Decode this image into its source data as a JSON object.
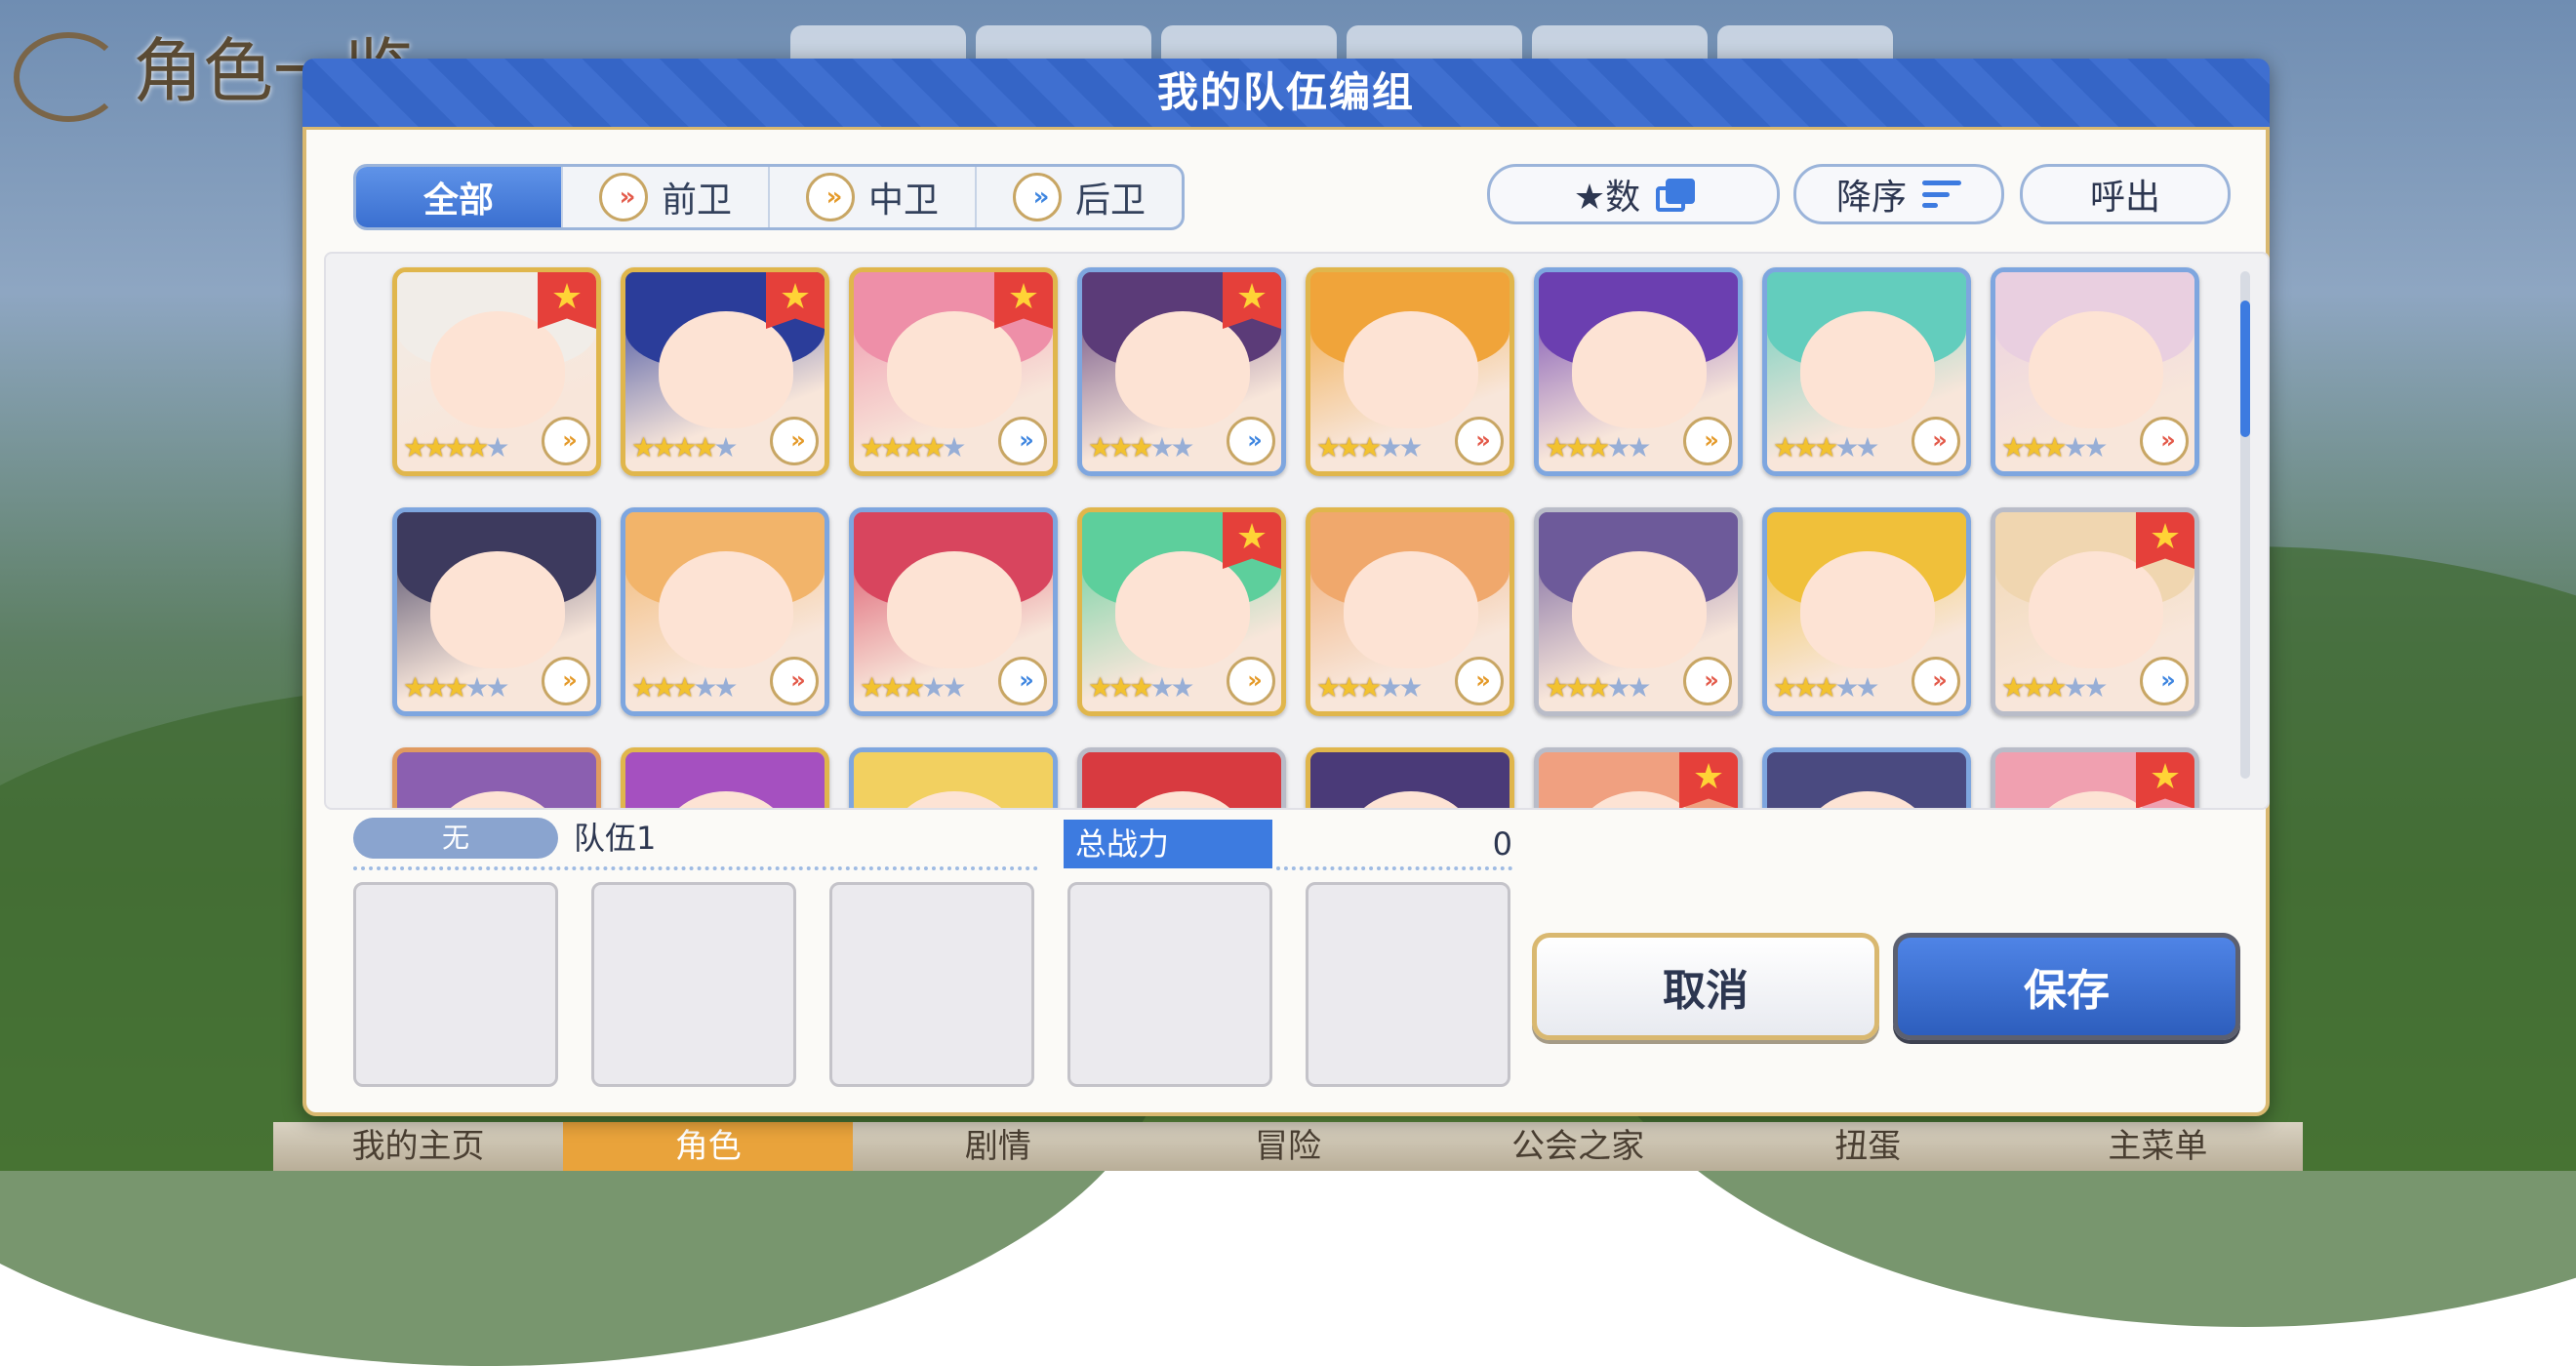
{
  "background": {
    "title": "角色一览",
    "nav": [
      "我的主页",
      "角色",
      "剧情",
      "冒险",
      "公会之家",
      "扭蛋",
      "主菜单"
    ]
  },
  "dialog": {
    "title": "我的队伍编组",
    "filters": [
      {
        "label": "全部",
        "icon": null
      },
      {
        "label": "前卫",
        "icon": "front-role-icon"
      },
      {
        "label": "中卫",
        "icon": "mid-role-icon"
      },
      {
        "label": "后卫",
        "icon": "back-role-icon"
      }
    ],
    "sort_by": "★数",
    "order": "降序",
    "call_out": "呼出"
  },
  "characters": [
    {
      "stars": 4,
      "favorite": true,
      "role": "mid",
      "frame": "gold",
      "hair": "#f1ede8"
    },
    {
      "stars": 4,
      "favorite": true,
      "role": "mid",
      "frame": "gold",
      "hair": "#2b3d9a"
    },
    {
      "stars": 4,
      "favorite": true,
      "role": "back",
      "frame": "gold",
      "hair": "#ee8fa8"
    },
    {
      "stars": 3,
      "favorite": true,
      "role": "back",
      "frame": "blue",
      "hair": "#5b3b78"
    },
    {
      "stars": 3,
      "favorite": false,
      "role": "front",
      "frame": "gold",
      "hair": "#f0a43a"
    },
    {
      "stars": 3,
      "favorite": false,
      "role": "mid",
      "frame": "blue",
      "hair": "#6b3fb0"
    },
    {
      "stars": 3,
      "favorite": false,
      "role": "front",
      "frame": "blue",
      "hair": "#63cdbd"
    },
    {
      "stars": 3,
      "favorite": false,
      "role": "front",
      "frame": "blue",
      "hair": "#e9cfe0"
    },
    {
      "stars": 3,
      "favorite": false,
      "role": "mid",
      "frame": "blue",
      "hair": "#3d3a5e"
    },
    {
      "stars": 3,
      "favorite": false,
      "role": "front",
      "frame": "blue",
      "hair": "#f2b46a"
    },
    {
      "stars": 3,
      "favorite": false,
      "role": "back",
      "frame": "blue",
      "hair": "#d8455e"
    },
    {
      "stars": 3,
      "favorite": true,
      "role": "mid",
      "frame": "gold",
      "hair": "#5dcf9c"
    },
    {
      "stars": 3,
      "favorite": false,
      "role": "mid",
      "frame": "gold",
      "hair": "#f0a86c"
    },
    {
      "stars": 3,
      "favorite": false,
      "role": "front",
      "frame": "silver",
      "hair": "#6d5a9a"
    },
    {
      "stars": 3,
      "favorite": false,
      "role": "front",
      "frame": "blue",
      "hair": "#f0c03a"
    },
    {
      "stars": 3,
      "favorite": true,
      "role": "back",
      "frame": "silver",
      "hair": "#f0d6b0"
    },
    {
      "stars": 0,
      "favorite": false,
      "role": "",
      "frame": "copper",
      "hair": "#8b5fb0"
    },
    {
      "stars": 0,
      "favorite": false,
      "role": "",
      "frame": "gold",
      "hair": "#a550c0"
    },
    {
      "stars": 0,
      "favorite": false,
      "role": "",
      "frame": "blue",
      "hair": "#f2d060"
    },
    {
      "stars": 0,
      "favorite": false,
      "role": "",
      "frame": "silver",
      "hair": "#d83a40"
    },
    {
      "stars": 0,
      "favorite": false,
      "role": "",
      "frame": "gold",
      "hair": "#4a3a78"
    },
    {
      "stars": 0,
      "favorite": true,
      "role": "",
      "frame": "silver",
      "hair": "#f0a080"
    },
    {
      "stars": 0,
      "favorite": false,
      "role": "",
      "frame": "blue",
      "hair": "#4a4a80"
    },
    {
      "stars": 0,
      "favorite": true,
      "role": "",
      "frame": "silver",
      "hair": "#f0a0b0"
    }
  ],
  "team": {
    "badge": "无",
    "name": "队伍1",
    "power_label": "总战力",
    "power_value": "0",
    "slots": 5
  },
  "buttons": {
    "cancel": "取消",
    "save": "保存"
  },
  "colors": {
    "accent": "#3d7be0",
    "header": "#3565c6",
    "gold": "#d9b870",
    "favorite": "#e5403a"
  }
}
